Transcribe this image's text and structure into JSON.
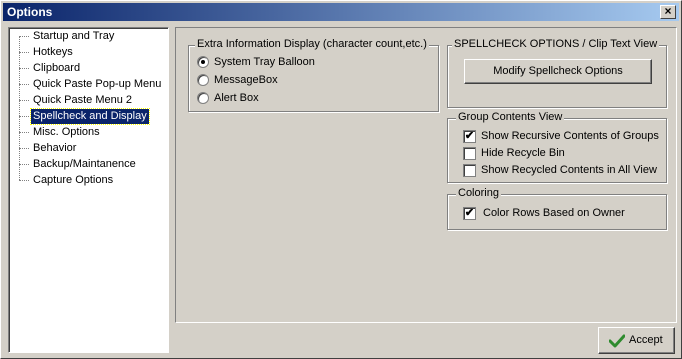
{
  "window": {
    "title": "Options",
    "close_glyph": "×"
  },
  "tree": {
    "items": [
      {
        "label": "Startup and Tray"
      },
      {
        "label": "Hotkeys"
      },
      {
        "label": "Clipboard"
      },
      {
        "label": "Quick Paste Pop-up Menu"
      },
      {
        "label": "Quick Paste Menu 2"
      },
      {
        "label": "Spellcheck and Display",
        "selected": true
      },
      {
        "label": "Misc. Options"
      },
      {
        "label": "Behavior"
      },
      {
        "label": "Backup/Maintanence"
      },
      {
        "label": "Capture Options"
      }
    ]
  },
  "extra_info": {
    "title": "Extra Information Display (character count,etc.)",
    "options": [
      {
        "label": "System Tray Balloon",
        "checked": true
      },
      {
        "label": "MessageBox",
        "checked": false
      },
      {
        "label": "Alert Box",
        "checked": false
      }
    ]
  },
  "spellcheck": {
    "title": "SPELLCHECK OPTIONS / Clip Text View",
    "button_label": "Modify Spellcheck Options"
  },
  "group_view": {
    "title": "Group Contents View",
    "options": [
      {
        "label": "Show Recursive Contents of Groups",
        "checked": true
      },
      {
        "label": "Hide Recycle Bin",
        "checked": false
      },
      {
        "label": "Show Recycled Contents in All View",
        "checked": false
      }
    ]
  },
  "coloring": {
    "title": "Coloring",
    "options": [
      {
        "label": "Color Rows Based on Owner",
        "checked": true
      }
    ]
  },
  "footer": {
    "accept_label": "Accept"
  },
  "check_glyph": "✔"
}
